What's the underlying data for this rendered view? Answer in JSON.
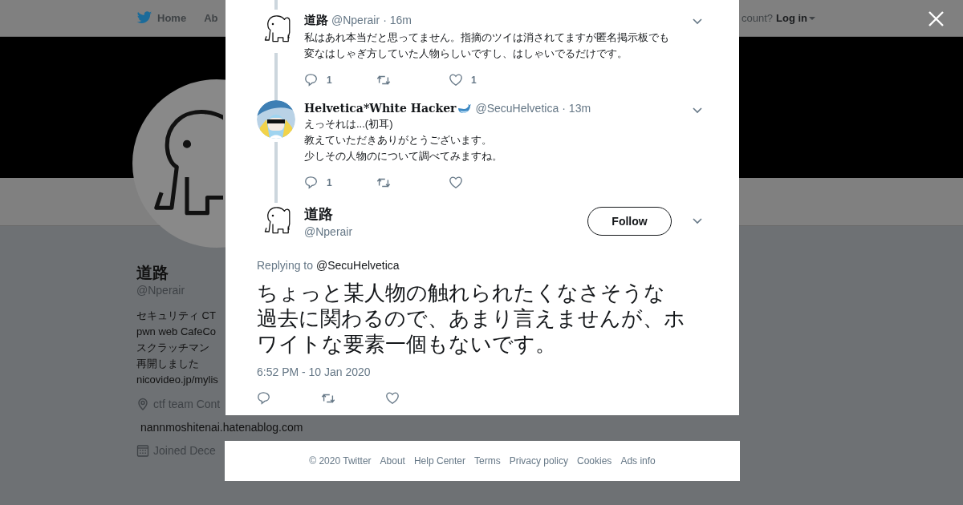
{
  "nav": {
    "items": [
      {
        "label": "Home",
        "kind": "home"
      },
      {
        "label": "Ab",
        "kind": "plain"
      }
    ],
    "account_prompt": "count?",
    "login": "Log in"
  },
  "profile": {
    "name": "道路",
    "handle": "@Nperair",
    "bio": [
      "セキュリティ CT",
      "pwn web CafeCo",
      "スクラッチマン",
      "再開しました",
      "nicovideo.jp/mylis"
    ],
    "meta": [
      {
        "kind": "location",
        "text": "ctf team Cont"
      },
      {
        "kind": "link",
        "text": "nannmoshitenai.hatenablog.com"
      },
      {
        "kind": "joined",
        "text": "Joined Dece"
      }
    ]
  },
  "replies": [
    {
      "kind": "plain",
      "avatar": {
        "kind": "elephant"
      },
      "name": "道路",
      "handle": "@Nperair",
      "separator": "·",
      "time": "16m",
      "lines": [
        "私はあれ本当だと思ってません。指摘のツイは消されてますが匿名掲示板でも",
        "変なはしゃぎ方していた人物らしいですし、はしゃいでるだけです。"
      ],
      "reply_count": "1",
      "like_count": "1"
    },
    {
      "kind": "styled",
      "name": "Helvetica*White Hacker",
      "handle": "@SecuHelvetica",
      "separator": "·",
      "time": "13m",
      "lines": [
        "えっそれは...(初耳)",
        "教えていただきありがとうございます。",
        "少しその人物のについて調べてみますね。"
      ],
      "reply_count": "1"
    }
  ],
  "tweet": {
    "name": "道路",
    "handle": "@Nperair",
    "follow": "Follow",
    "replying_label": "Replying to",
    "replying_to": "@SecuHelvetica",
    "lines": [
      "ちょっと某人物の触れられたくなさそうな",
      "過去に関わるので、あまり言えませんが、ホ",
      "ワイトな要素一個もないです。"
    ],
    "timestamp": "6:52 PM - 10 Jan 2020"
  },
  "footer": {
    "links": [
      "© 2020 Twitter",
      "About",
      "Help Center",
      "Terms",
      "Privacy policy",
      "Cookies",
      "Ads info"
    ]
  }
}
